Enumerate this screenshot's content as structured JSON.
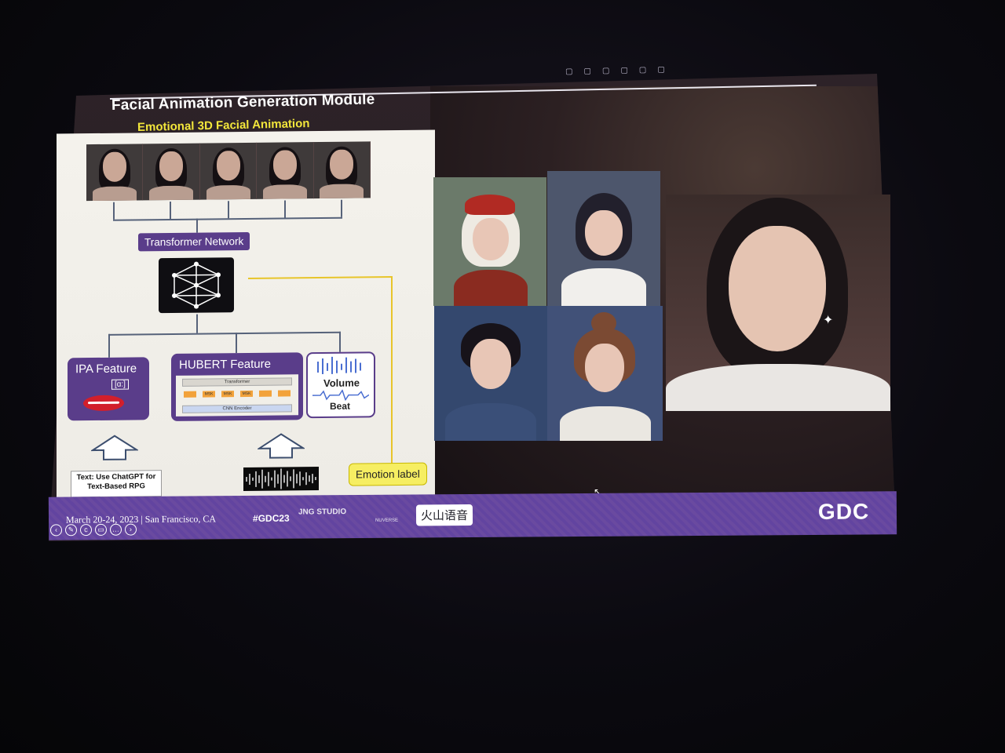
{
  "slide": {
    "title": "Facial Animation Generation Module",
    "subtitle": "Emotional 3D Facial Animation"
  },
  "diagram": {
    "transformer_label": "Transformer Network",
    "ipa_label": "IPA Feature",
    "ipa_symbol": "[ɑ:]",
    "hubert_label": "HUBERT Feature",
    "hubert_transformer": "Transformer",
    "hubert_encoder": "CNN Encoder",
    "hubert_mask": "MSK",
    "volume_label": "Volume",
    "beat_label": "Beat",
    "text_input": "Text: Use ChatGPT for Text-Based RPG",
    "emotion_label": "Emotion label"
  },
  "footer": {
    "date_location": "March 20-24, 2023  |  San Francisco, CA",
    "hashtag": "#GDC23",
    "jng": "JNG STUDIO",
    "nuverse": "NUVERSE",
    "volcano": "火山语音",
    "gdc": "GDC"
  },
  "colors": {
    "purple": "#5a3d8a",
    "yellow": "#f2e63b",
    "panel": "#f4f2ec"
  }
}
